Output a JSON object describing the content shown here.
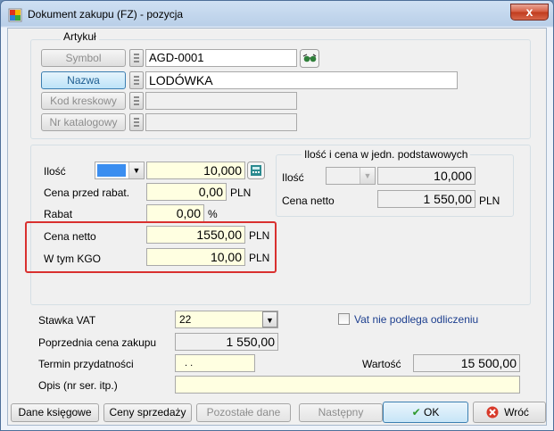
{
  "window": {
    "title": "Dokument zakupu (FZ) - pozycja",
    "close_glyph": "x"
  },
  "artykul": {
    "group_title": "Artykuł",
    "symbol_label": "Symbol",
    "symbol_value": "AGD-0001",
    "nazwa_label": "Nazwa",
    "nazwa_value": "LODÓWKA",
    "kod_label": "Kod kreskowy",
    "kod_value": "",
    "nr_label": "Nr katalogowy",
    "nr_value": ""
  },
  "pricing": {
    "ilosc_label": "Ilość",
    "ilosc_value": "10,000",
    "cena_przed_label": "Cena przed rabat.",
    "cena_przed_value": "0,00",
    "cena_przed_unit": "PLN",
    "rabat_label": "Rabat",
    "rabat_value": "0,00",
    "rabat_unit": "%",
    "cena_netto_label": "Cena netto",
    "cena_netto_value": "1550,00",
    "cena_netto_unit": "PLN",
    "kgo_label": "W tym KGO",
    "kgo_value": "10,00",
    "kgo_unit": "PLN"
  },
  "base_units": {
    "group_title": "Ilość i cena w jedn. podstawowych",
    "ilosc_label": "Ilość",
    "ilosc_value": "10,000",
    "cena_label": "Cena netto",
    "cena_value": "1 550,00",
    "cena_unit": "PLN"
  },
  "vat": {
    "stawka_label": "Stawka VAT",
    "stawka_value": "22",
    "checkbox_label": "Vat nie podlega odliczeniu",
    "checked": false,
    "poprzednia_label": "Poprzednia cena zakupu",
    "poprzednia_value": "1 550,00",
    "termin_label": "Termin przydatności",
    "termin_value": ". .",
    "wartosc_label": "Wartość",
    "wartosc_value": "15 500,00",
    "opis_label": "Opis (nr ser. itp.)",
    "opis_value": ""
  },
  "buttons": {
    "dane": "Dane księgowe",
    "ceny": "Ceny sprzedaży",
    "pozostale": "Pozostałe dane",
    "nastepny": "Następny",
    "ok": "OK",
    "wroc": "Wróć"
  },
  "colors": {
    "highlight": "#d9302f",
    "yellow_field": "#ffffe1",
    "combo_blue": "#3b8ef0"
  }
}
